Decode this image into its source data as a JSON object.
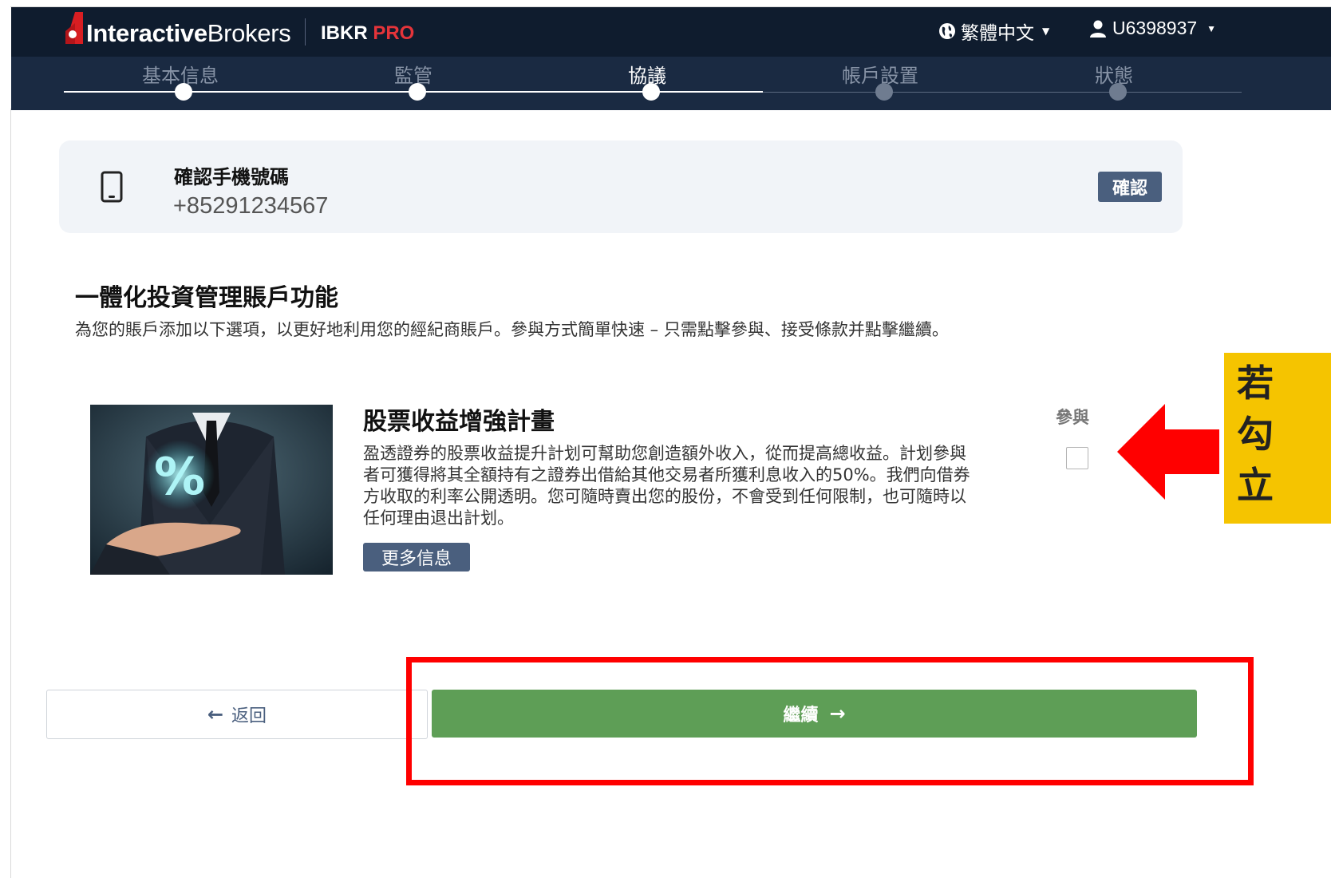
{
  "header": {
    "brand_bold": "Interactive",
    "brand_thin": "Brokers",
    "product": "IBKR",
    "product_accent": "PRO",
    "language": "繁體中文",
    "account": "U6398937",
    "brand_color": "#0f1c2e",
    "accent_color": "#e5343a"
  },
  "steps": [
    {
      "label": "基本信息",
      "state": "done"
    },
    {
      "label": "監管",
      "state": "done"
    },
    {
      "label": "協議",
      "state": "active"
    },
    {
      "label": "帳戶設置",
      "state": "todo"
    },
    {
      "label": "狀態",
      "state": "todo"
    }
  ],
  "phone_card": {
    "title": "確認手機號碼",
    "number": "+85291234567",
    "confirm_label": "確認",
    "icon": "mobile-phone-icon"
  },
  "section": {
    "title": "一體化投資管理賬戶功能",
    "description": "為您的賬戶添加以下選項，以更好地利用您的經紀商賬戶。參與方式簡單快速 – 只需點擊參與、接受條款并點擊繼續。"
  },
  "program": {
    "title": "股票收益增強計畫",
    "description": "盈透證券的股票收益提升計划可幫助您創造額外收入，從而提高總收益。計划參與者可獲得將其全額持有之證券出借給其他交易者所獲利息收入的50%。我們向借券方收取的利率公開透明。您可隨時賣出您的股份，不會受到任何限制，也可隨時以任何理由退出計划。",
    "more_label": "更多信息",
    "join_label": "參與",
    "joined": false,
    "image_symbol": "%"
  },
  "annotation": {
    "text": "若 勾 立",
    "arrow_color": "#ff0000",
    "box_color": "#f5c400"
  },
  "footer": {
    "back_label": "返回",
    "continue_label": "繼續",
    "continue_color": "#5e9e56"
  }
}
